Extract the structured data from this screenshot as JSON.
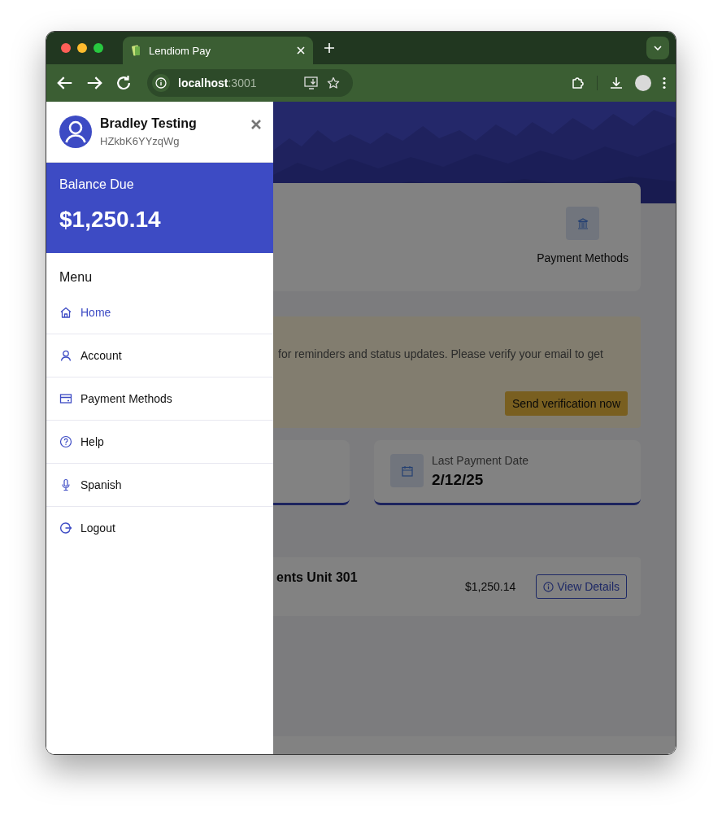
{
  "browser": {
    "tab_title": "Lendiom Pay",
    "url_host": "localhost",
    "url_port": ":3001"
  },
  "drawer": {
    "user": {
      "name": "Bradley Testing",
      "id": "HZkbK6YYzqWg"
    },
    "balance": {
      "label": "Balance Due",
      "amount": "$1,250.14"
    },
    "menu_title": "Menu",
    "items": [
      {
        "label": "Home",
        "kind": "home",
        "selected": true
      },
      {
        "label": "Account",
        "kind": "person",
        "selected": false
      },
      {
        "label": "Payment Methods",
        "kind": "card",
        "selected": false
      },
      {
        "label": "Help",
        "kind": "help",
        "selected": false
      },
      {
        "label": "Spanish",
        "kind": "mic",
        "selected": false
      },
      {
        "label": "Logout",
        "kind": "logout",
        "selected": false
      }
    ]
  },
  "page": {
    "quick_action": {
      "label": "Payment Methods"
    },
    "alert": {
      "text": "for reminders and status updates. Please verify your email to get",
      "button": "Send verification now"
    },
    "stat": {
      "label": "Last Payment Date",
      "value": "2/12/25"
    },
    "property": {
      "name": "ents Unit 301",
      "amount": "$1,250.14",
      "button": "View Details"
    }
  }
}
